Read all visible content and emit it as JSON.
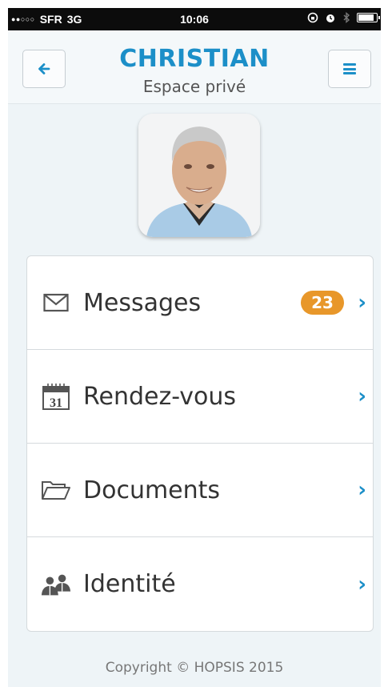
{
  "status_bar": {
    "signal": "●●○○○",
    "carrier": "SFR",
    "network": "3G",
    "time": "10:06",
    "battery_level": 0.85
  },
  "header": {
    "title": "CHRISTIAN",
    "subtitle": "Espace privé",
    "back_icon": "arrow-left-icon",
    "menu_icon": "hamburger-icon"
  },
  "menu": {
    "items": [
      {
        "label": "Messages",
        "icon": "envelope-icon",
        "badge": "23"
      },
      {
        "label": "Rendez-vous",
        "icon": "calendar-icon",
        "calendar_day": "31"
      },
      {
        "label": "Documents",
        "icon": "folder-icon"
      },
      {
        "label": "Identité",
        "icon": "users-icon"
      }
    ]
  },
  "footer": {
    "copyright": "Copyright © HOPSIS 2015"
  },
  "colors": {
    "accent": "#1c8fc8",
    "badge": "#e8972a",
    "background": "#eef4f7"
  }
}
